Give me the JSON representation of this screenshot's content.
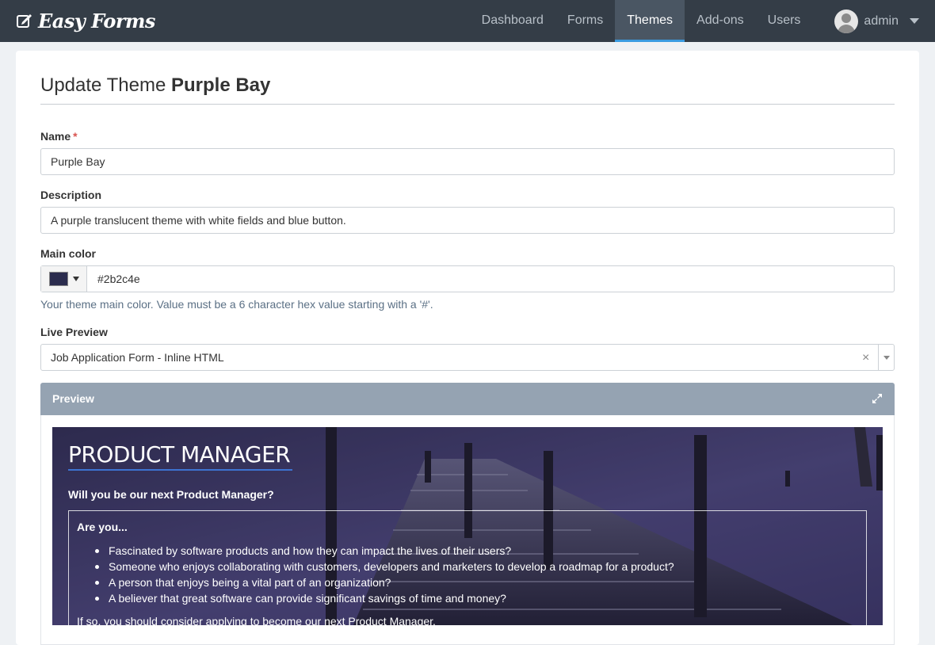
{
  "app": {
    "brand": "Easy Forms"
  },
  "nav": {
    "items": [
      {
        "label": "Dashboard"
      },
      {
        "label": "Forms"
      },
      {
        "label": "Themes"
      },
      {
        "label": "Add-ons"
      },
      {
        "label": "Users"
      }
    ],
    "active_item": "Themes",
    "user": "admin"
  },
  "page": {
    "title_prefix": "Update Theme",
    "title_name": "Purple Bay"
  },
  "form": {
    "name_label": "Name",
    "name_required": "*",
    "name_value": "Purple Bay",
    "description_label": "Description",
    "description_value": "A purple translucent theme with white fields and blue button.",
    "main_color_label": "Main color",
    "main_color_value": "#2b2c4e",
    "main_color_help": "Your theme main color. Value must be a 6 character hex value starting with a '#'.",
    "live_preview_label": "Live Preview",
    "live_preview_value": "Job Application Form - Inline HTML",
    "clear_glyph": "×"
  },
  "preview": {
    "header": "Preview",
    "form_title": "PRODUCT MANAGER",
    "subtitle": "Will you be our next Product Manager?",
    "box_title": "Are you...",
    "bullets": [
      "Fascinated by software products and how they can impact the lives of their users?",
      "Someone who enjoys collaborating with customers, developers and marketers to develop a roadmap for a product?",
      "A person that enjoys being a vital part of an organization?",
      "A believer that great software can provide significant savings of time and money?"
    ],
    "footer_text": "If so, you should consider applying to become our next Product Manager."
  },
  "colors": {
    "navbar": "#343d47",
    "active_accent": "#3b9be0",
    "theme_main": "#2b2c4e",
    "preview_header": "#95a3b2",
    "required": "#d9534f"
  },
  "icons": {
    "brand": "edit-icon",
    "user": "user-avatar-icon",
    "dropdown": "caret-down-icon",
    "expand": "expand-icon"
  }
}
